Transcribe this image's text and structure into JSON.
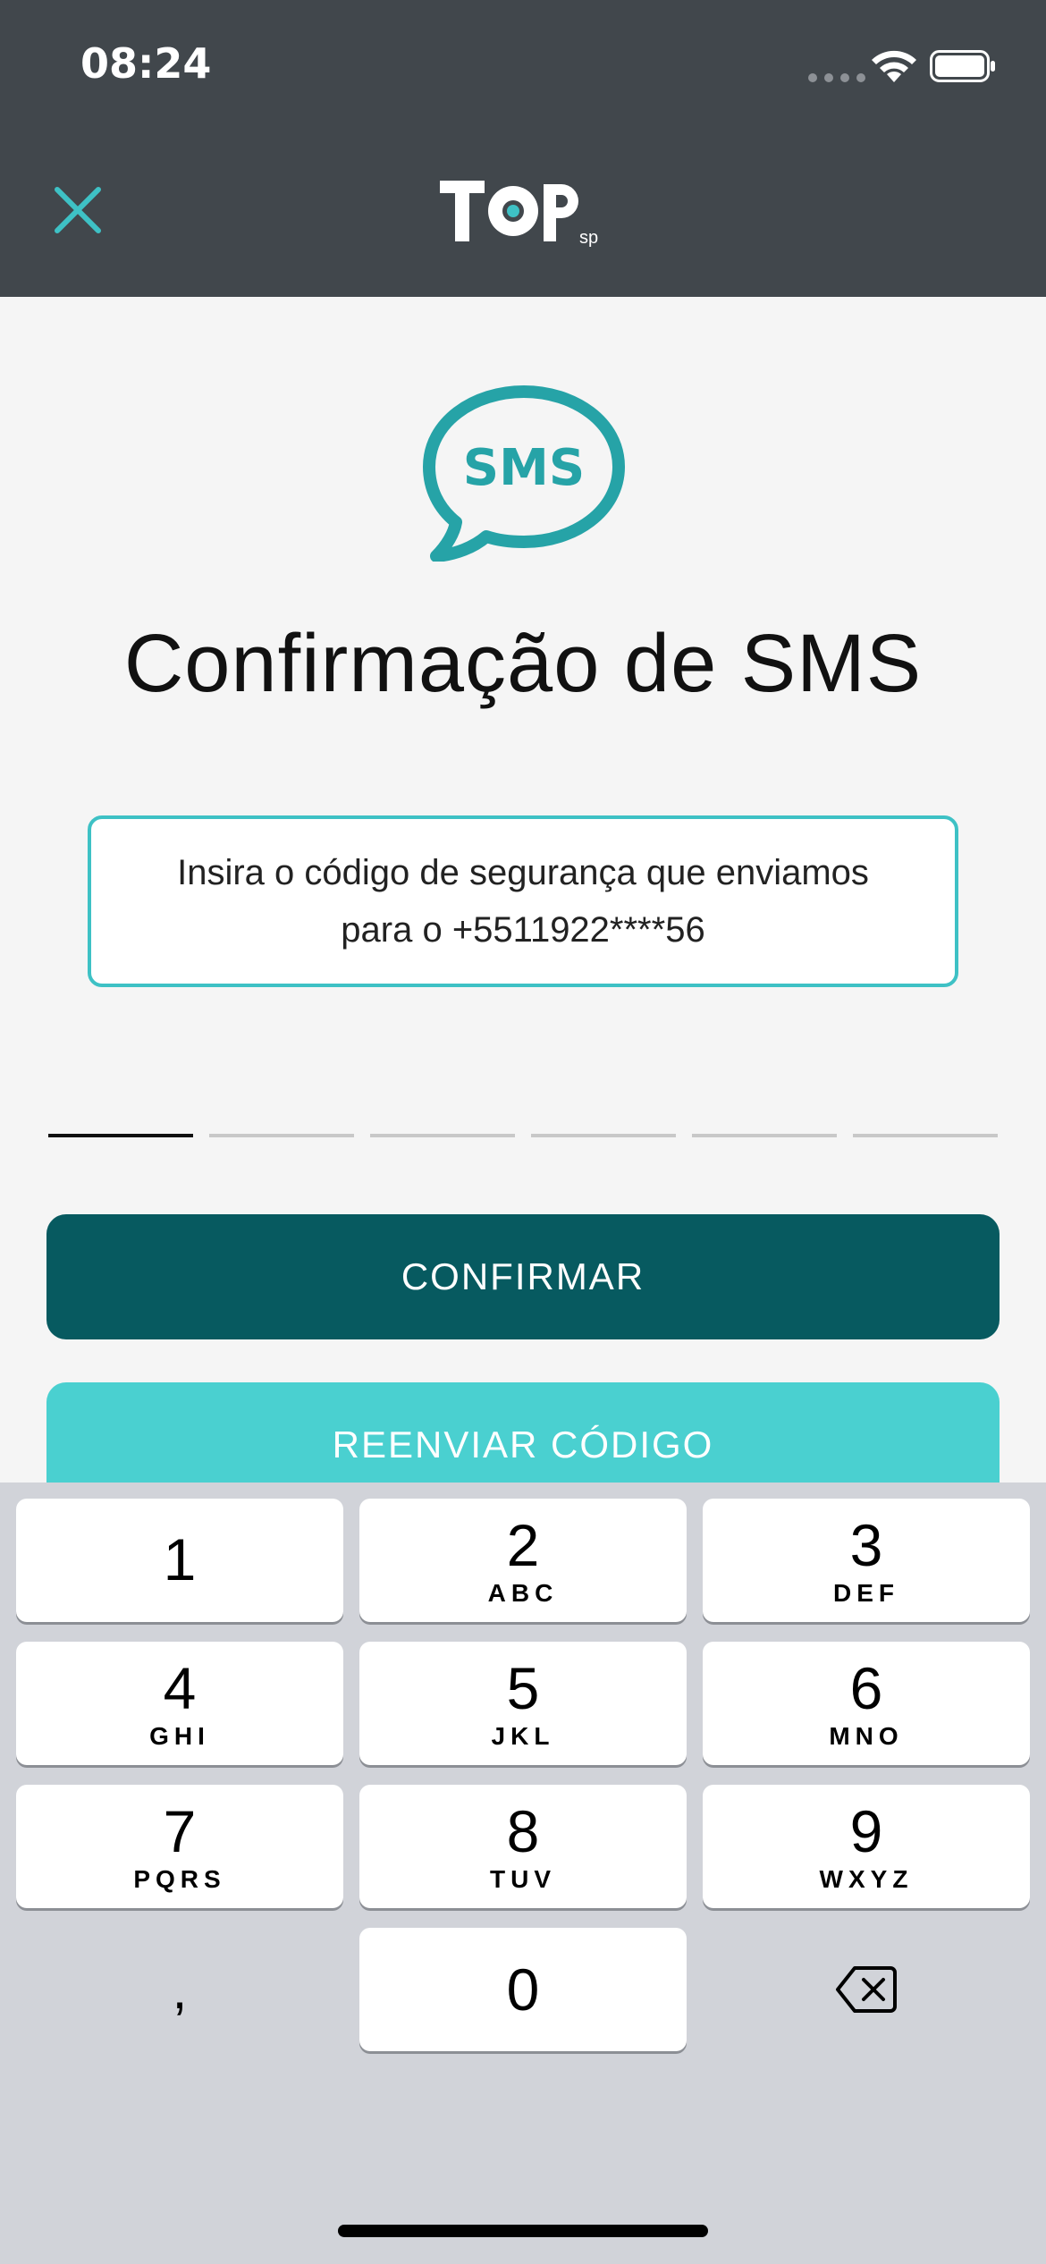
{
  "status_bar": {
    "time": "08:24"
  },
  "header": {
    "logo_text": "TOP",
    "logo_sub": "sp"
  },
  "content": {
    "icon_label": "SMS",
    "title": "Confirmação de SMS",
    "info_line1": "Insira o código de segurança que enviamos",
    "info_line2": "para o +5511922****56",
    "confirm_label": "CONFIRMAR",
    "resend_label": "REENVIAR CÓDIGO"
  },
  "colors": {
    "header_bg": "#41474c",
    "accent_teal": "#3ec1c5",
    "confirm_bg": "#075a60",
    "resend_bg": "#4ad0d0"
  },
  "keyboard": {
    "keys": [
      {
        "num": "1",
        "letters": ""
      },
      {
        "num": "2",
        "letters": "ABC"
      },
      {
        "num": "3",
        "letters": "DEF"
      },
      {
        "num": "4",
        "letters": "GHI"
      },
      {
        "num": "5",
        "letters": "JKL"
      },
      {
        "num": "6",
        "letters": "MNO"
      },
      {
        "num": "7",
        "letters": "PQRS"
      },
      {
        "num": "8",
        "letters": "TUV"
      },
      {
        "num": "9",
        "letters": "WXYZ"
      },
      {
        "num": "0",
        "letters": ""
      }
    ],
    "comma": ",",
    "delete_icon": "delete-icon"
  }
}
